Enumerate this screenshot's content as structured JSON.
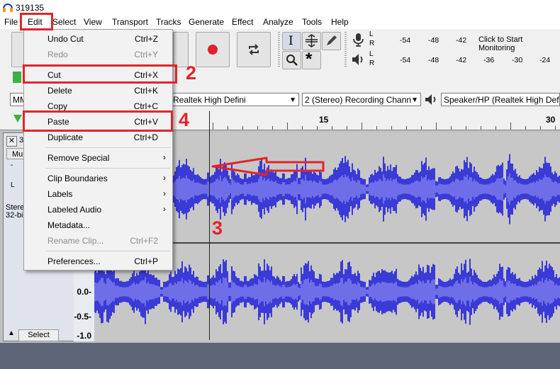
{
  "window": {
    "title": "319135"
  },
  "menubar": {
    "items": [
      "File",
      "Edit",
      "Select",
      "View",
      "Transport",
      "Tracks",
      "Generate",
      "Effect",
      "Analyze",
      "Tools",
      "Help"
    ]
  },
  "edit_menu": {
    "items": [
      {
        "label": "Undo Cut",
        "shortcut": "Ctrl+Z",
        "enabled": true
      },
      {
        "label": "Redo",
        "shortcut": "Ctrl+Y",
        "enabled": false
      },
      {
        "label": "Cut",
        "shortcut": "Ctrl+X",
        "enabled": true
      },
      {
        "label": "Delete",
        "shortcut": "Ctrl+K",
        "enabled": true
      },
      {
        "label": "Copy",
        "shortcut": "Ctrl+C",
        "enabled": true
      },
      {
        "label": "Paste",
        "shortcut": "Ctrl+V",
        "enabled": true
      },
      {
        "label": "Duplicate",
        "shortcut": "Ctrl+D",
        "enabled": true
      },
      {
        "label": "Remove Special",
        "submenu": true,
        "enabled": true
      },
      {
        "label": "Clip Boundaries",
        "submenu": true,
        "enabled": true
      },
      {
        "label": "Labels",
        "submenu": true,
        "enabled": true
      },
      {
        "label": "Labeled Audio",
        "submenu": true,
        "enabled": true
      },
      {
        "label": "Metadata...",
        "enabled": true
      },
      {
        "label": "Rename Clip...",
        "shortcut": "Ctrl+F2",
        "enabled": false
      },
      {
        "label": "Preferences...",
        "shortcut": "Ctrl+P",
        "enabled": true
      }
    ]
  },
  "meters": {
    "record_channels": [
      "L",
      "R"
    ],
    "record_scale": [
      "-54",
      "-48",
      "-42"
    ],
    "record_hint": "Click to Start Monitoring",
    "play_channels": [
      "L",
      "R"
    ],
    "play_scale": [
      "-54",
      "-48",
      "-42",
      "-36",
      "-30",
      "-24"
    ]
  },
  "device_toolbar": {
    "host_partial": "MM",
    "recording_device": "Realtek High Defini",
    "recording_channels": "2 (Stereo) Recording Chann",
    "playback_device": "Speaker/HP (Realtek High Defin"
  },
  "timeline": {
    "labels": [
      "15",
      "30"
    ]
  },
  "track": {
    "close_glyph": "✕",
    "name_partial": "3",
    "mute_partial": "Mu",
    "rate_l_partial": "L",
    "info_line1": "Stere",
    "info_line2": "32-bi",
    "select_label": "Select",
    "scale_labels": [
      "0.0-",
      "-0.5-",
      "-1.0"
    ]
  },
  "annotations": {
    "step2": "2",
    "step3": "3",
    "step4": "4"
  },
  "colors": {
    "annotation_red": "#e3242b",
    "waveform": "#3a3ad6",
    "waveform_light": "#6e6ee8",
    "record_red": "#e0202f"
  }
}
